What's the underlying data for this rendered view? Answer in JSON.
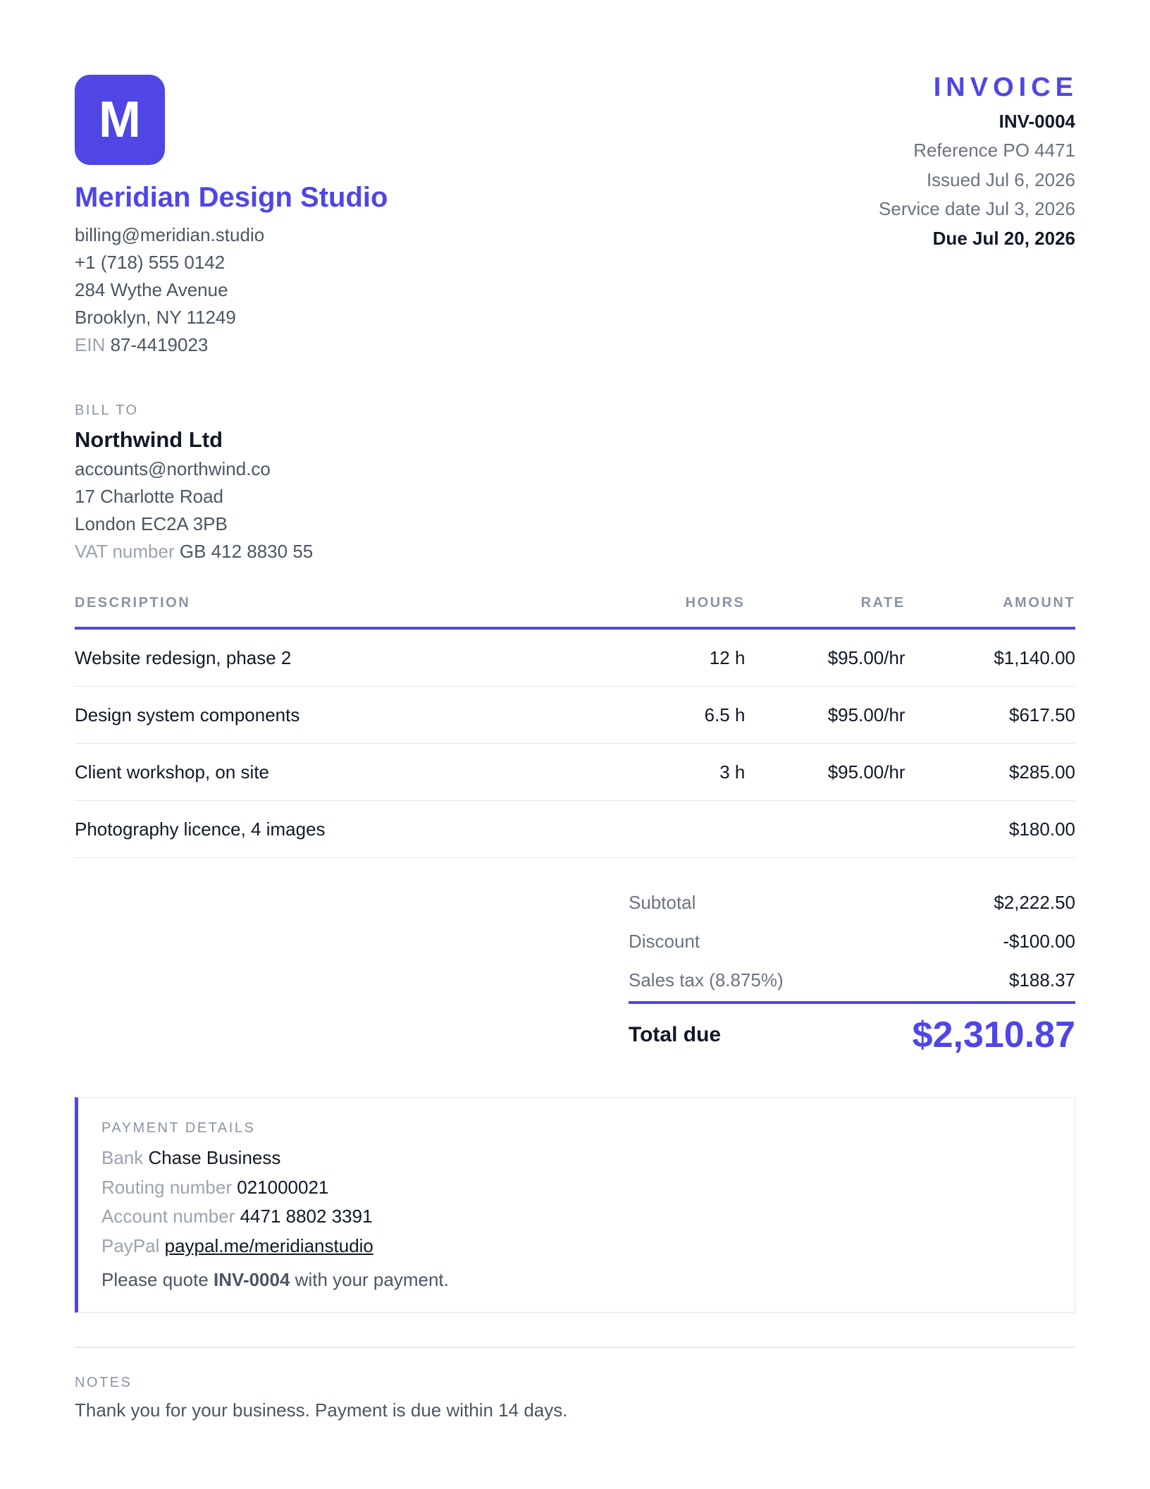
{
  "company": {
    "logo_letter": "M",
    "name": "Meridian Design Studio",
    "email": "billing@meridian.studio",
    "phone": "+1 (718) 555 0142",
    "address1": "284 Wythe Avenue",
    "address2": "Brooklyn, NY 11249",
    "ein_label": "EIN",
    "ein": "87-4419023"
  },
  "invoice": {
    "title": "INVOICE",
    "number": "INV-0004",
    "reference": "Reference PO 4471",
    "issued": "Issued Jul 6, 2026",
    "service_date": "Service date Jul 3, 2026",
    "due": "Due Jul 20, 2026"
  },
  "bill_to": {
    "label": "BILL TO",
    "name": "Northwind Ltd",
    "email": "accounts@northwind.co",
    "address1": "17 Charlotte Road",
    "address2": "London EC2A 3PB",
    "vat_label": "VAT number",
    "vat": "GB 412 8830 55"
  },
  "table": {
    "headers": [
      "DESCRIPTION",
      "HOURS",
      "RATE",
      "AMOUNT"
    ],
    "rows": [
      {
        "description": "Website redesign, phase 2",
        "hours": "12 h",
        "rate": "$95.00/hr",
        "amount": "$1,140.00"
      },
      {
        "description": "Design system components",
        "hours": "6.5 h",
        "rate": "$95.00/hr",
        "amount": "$617.50"
      },
      {
        "description": "Client workshop, on site",
        "hours": "3 h",
        "rate": "$95.00/hr",
        "amount": "$285.00"
      },
      {
        "description": "Photography licence, 4 images",
        "hours": "",
        "rate": "",
        "amount": "$180.00"
      }
    ]
  },
  "totals": {
    "subtotal_label": "Subtotal",
    "subtotal": "$2,222.50",
    "discount_label": "Discount",
    "discount": "-$100.00",
    "tax_label": "Sales tax (8.875%)",
    "tax": "$188.37",
    "total_label": "Total due",
    "total": "$2,310.87"
  },
  "payment": {
    "label": "PAYMENT DETAILS",
    "bank_label": "Bank",
    "bank": "Chase Business",
    "routing_label": "Routing number",
    "routing": "021000021",
    "account_label": "Account number",
    "account": "4471 8802 3391",
    "paypal_label": "PayPal",
    "paypal": "paypal.me/meridianstudio",
    "quote_prefix": "Please quote",
    "quote_ref": "INV-0004",
    "quote_suffix": "with your payment."
  },
  "notes": {
    "label": "NOTES",
    "text": "Thank you for your business. Payment is due within 14 days."
  },
  "colors": {
    "accent": "#4f46e5"
  }
}
